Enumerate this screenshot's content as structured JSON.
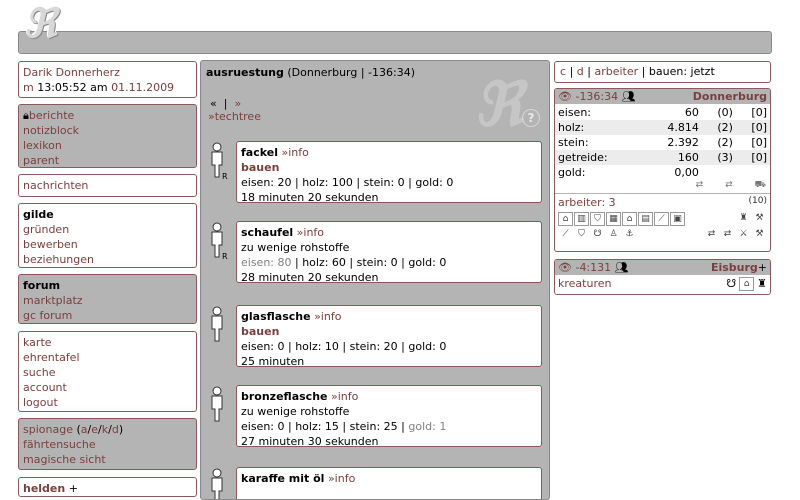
{
  "logo": {
    "text": "ℜ"
  },
  "user": {
    "name": "Darik Donnerherz",
    "prefix": "m",
    "time": "13:05:52 am",
    "date": "01.11.2009"
  },
  "nav1": [
    "berichte",
    "notizblock",
    "lexikon",
    "parent"
  ],
  "nav2": [
    "nachrichten"
  ],
  "nav3": {
    "title": "gilde",
    "items": [
      "gründen",
      "bewerben",
      "beziehungen"
    ]
  },
  "nav4": {
    "title": "forum",
    "items": [
      "marktplatz",
      "gc forum"
    ]
  },
  "nav5": [
    "karte",
    "ehrentafel",
    "suche",
    "account",
    "logout"
  ],
  "nav6": {
    "spionage": "spionage",
    "letters": [
      "a",
      "e",
      "k",
      "d"
    ],
    "items": [
      "fährtensuche",
      "magische sicht"
    ]
  },
  "nav7": {
    "label": "helden",
    "plus": "+"
  },
  "middle": {
    "title": "ausruestung",
    "subtitle": "(Donnerburg | -136:34)",
    "pager": {
      "first": "«",
      "sep": "|",
      "next": "»"
    },
    "techtree": "»techtree",
    "help": "?",
    "watermark": "ℜ",
    "items": [
      {
        "name": "fackel",
        "info": "»info",
        "action": "bauen",
        "cost": "eisen: 20 | holz: 100 | stein: 0 | gold: 0",
        "duration": "18 minuten 20 sekunden",
        "badge": "R"
      },
      {
        "name": "schaufel",
        "info": "»info",
        "warn": "zu wenige rohstoffe",
        "cost_dim": "eisen: 80",
        "cost": " | holz: 60 | stein: 0 | gold: 0",
        "duration": "28 minuten 20 sekunden",
        "badge": "R"
      },
      {
        "name": "glasflasche",
        "info": "»info",
        "action": "bauen",
        "cost": "eisen: 0 | holz: 10 | stein: 20 | gold: 0",
        "duration": "25 minuten"
      },
      {
        "name": "bronzeflasche",
        "info": "»info",
        "warn": "zu wenige rohstoffe",
        "cost": "eisen: 0 | holz: 15 | stein: 25 | ",
        "cost_dim": "gold: 1",
        "duration": "27 minuten 30 sekunden"
      },
      {
        "name": "karaffe mit öl",
        "info": "»info"
      }
    ]
  },
  "right_top": {
    "c": "c",
    "d": "d",
    "arbeiter": "arbeiter",
    "bauen": "bauen: jetzt",
    "sep": "|"
  },
  "village": {
    "coords": "-136:34",
    "name": "Donnerburg",
    "resources": [
      {
        "label": "eisen:",
        "value": "60",
        "rate": "(0)",
        "slot": "[0]"
      },
      {
        "label": "holz:",
        "value": "4.814",
        "rate": "(2)",
        "slot": "[0]"
      },
      {
        "label": "stein:",
        "value": "2.392",
        "rate": "(2)",
        "slot": "[0]"
      },
      {
        "label": "getreide:",
        "value": "160",
        "rate": "(3)",
        "slot": "[0]"
      },
      {
        "label": "gold:",
        "value": "0,00",
        "rate": "",
        "slot": ""
      }
    ],
    "arbeiter_label": "arbeiter: 3",
    "arbeiter_count": "(10)"
  },
  "village2": {
    "coords": "-4:131",
    "name": "Eisburg",
    "plus": "+",
    "kreaturen": "kreaturen"
  },
  "colors": {
    "link": "#7a3f3f",
    "panel": "#b4b4b4",
    "border": "#8a5a5a"
  }
}
